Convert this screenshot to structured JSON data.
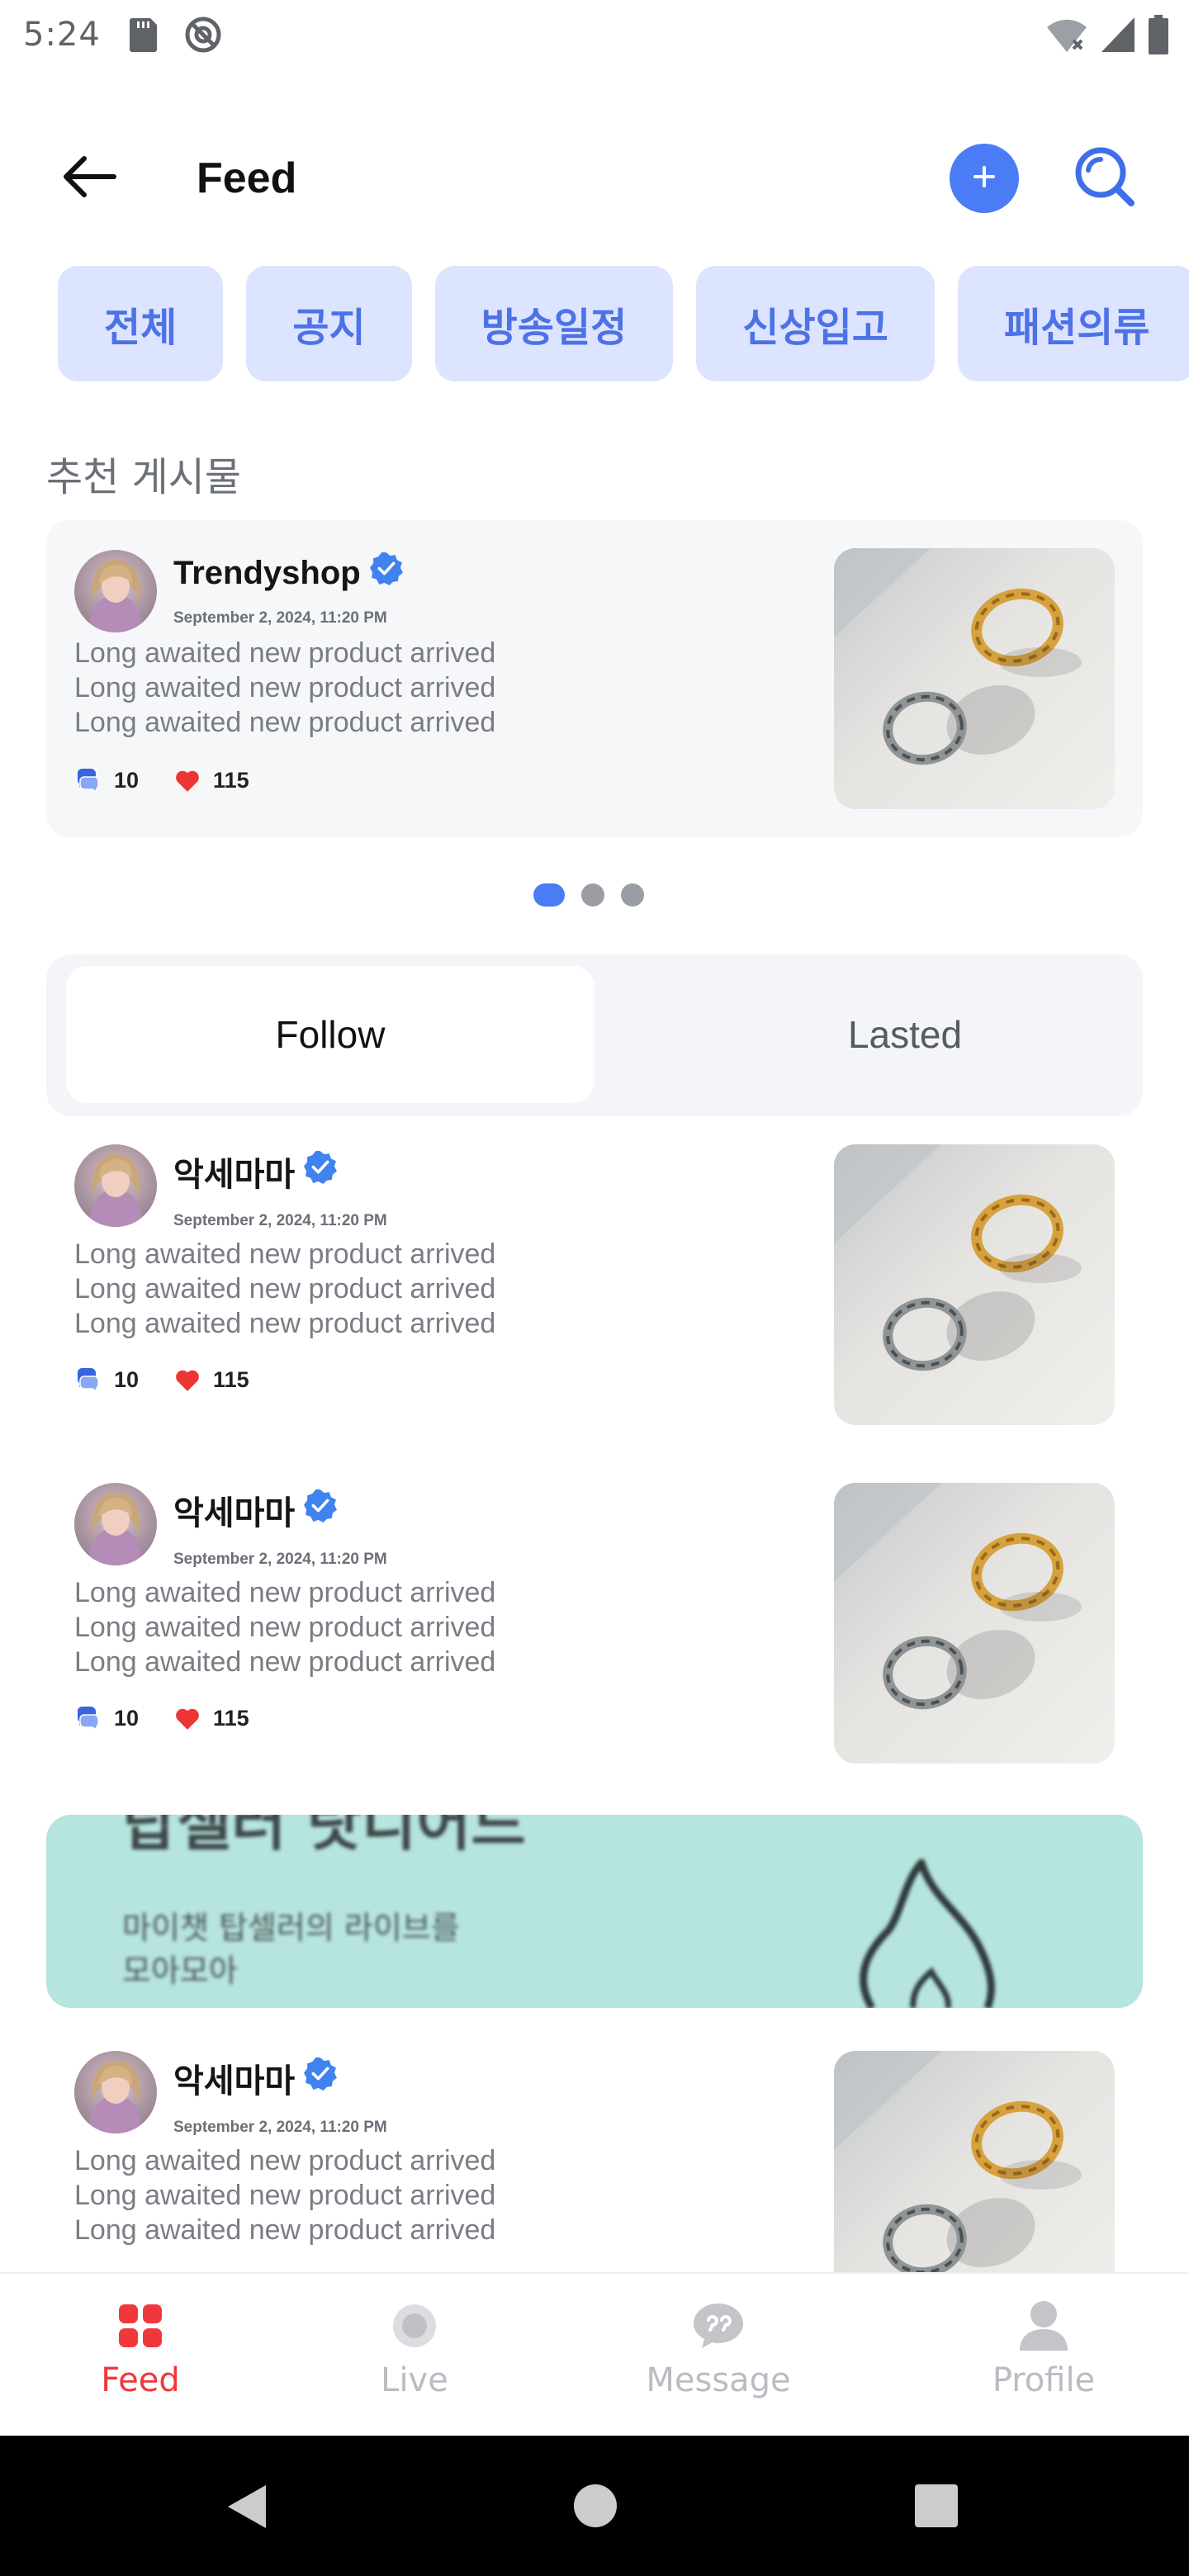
{
  "status_bar": {
    "time": "5:24"
  },
  "header": {
    "title": "Feed"
  },
  "categories": [
    "전체",
    "공지",
    "방송일정",
    "신상입고",
    "패션의류"
  ],
  "recommended": {
    "title": "추천 게시물",
    "post": {
      "author": "Trendyshop",
      "date": "September 2, 2024, 11:20 PM",
      "lines": [
        "Long awaited new product arrived",
        "Long awaited new product arrived",
        "Long awaited new product arrived"
      ],
      "comments": "10",
      "likes": "115"
    }
  },
  "tabs": {
    "follow": "Follow",
    "lasted": "Lasted"
  },
  "posts": [
    {
      "author": "악세마마",
      "date": "September 2, 2024, 11:20 PM",
      "lines": [
        "Long awaited new product arrived",
        "Long awaited new product arrived",
        "Long awaited new product arrived"
      ],
      "comments": "10",
      "likes": "115"
    },
    {
      "author": "악세마마",
      "date": "September 2, 2024, 11:20 PM",
      "lines": [
        "Long awaited new product arrived",
        "Long awaited new product arrived",
        "Long awaited new product arrived"
      ],
      "comments": "10",
      "likes": "115"
    },
    {
      "author": "악세마마",
      "date": "September 2, 2024, 11:20 PM",
      "lines": [
        "Long awaited new product arrived",
        "Long awaited new product arrived",
        "Long awaited new product arrived"
      ]
    }
  ],
  "banner": {
    "headline": "탑셀러 랏디어드",
    "subtitle_line1": "마이챗 탑셀러의 라이브를",
    "subtitle_line2": "모아모아"
  },
  "bottom_nav": [
    {
      "label": "Feed",
      "icon": "grid-icon",
      "active": true
    },
    {
      "label": "Live",
      "icon": "live-icon",
      "active": false
    },
    {
      "label": "Message",
      "icon": "chat-icon",
      "active": false
    },
    {
      "label": "Profile",
      "icon": "person-icon",
      "active": false
    }
  ],
  "colors": {
    "accent": "#4a7cf5",
    "active_nav": "#f0383c",
    "chip_bg": "#dce4ff",
    "banner_bg": "#b6e4df"
  }
}
